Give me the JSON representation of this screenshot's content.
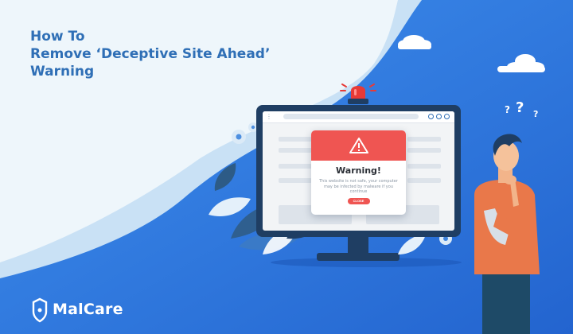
{
  "headline": {
    "line1": "How To",
    "line2": "Remove ‘Deceptive Site Ahead’",
    "line3": "Warning"
  },
  "warning_popup": {
    "title": "Warning!",
    "message": "This website is not safe, your computer may be infected by malware if you continue",
    "close_label": "CLOSE"
  },
  "brand": {
    "name": "MalCare"
  },
  "decor": {
    "question_marks": [
      "?",
      "?",
      "?"
    ]
  },
  "icons": [
    "alarm-siren-icon",
    "warning-triangle-icon",
    "gear-icon",
    "cloud-icon",
    "shield-logo-icon",
    "leaf-plant-icon"
  ],
  "colors": {
    "accent_blue": "#2f6fb6",
    "warning_red": "#ef5552",
    "bg_blue": "#2c7be5",
    "shirt_orange": "#e9784a"
  }
}
